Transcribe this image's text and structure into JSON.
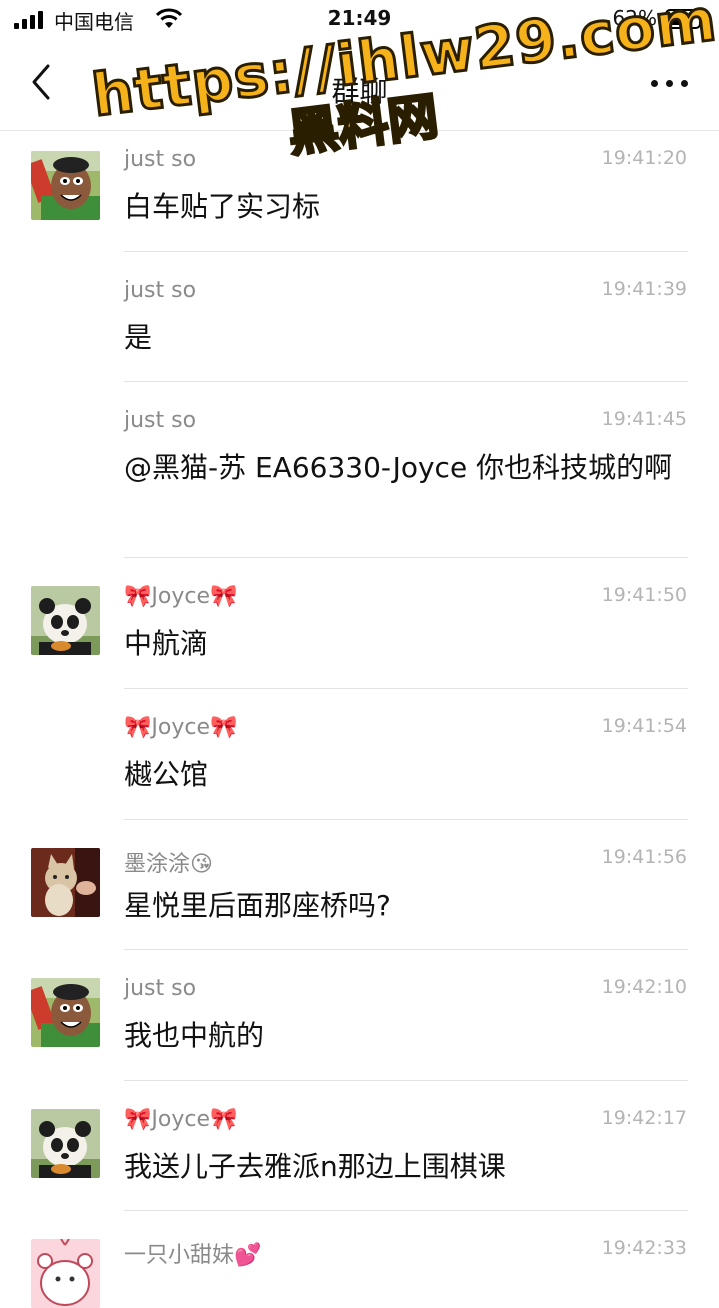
{
  "status_bar": {
    "carrier": "中国电信",
    "time": "21:49",
    "battery_percent": "62%",
    "battery_level": 0.62
  },
  "nav": {
    "title": "群聊",
    "back_icon": "chevron-left-icon",
    "more_icon": "more-dots-icon"
  },
  "watermark": {
    "url": "https://ihlw29.com",
    "text": "黑料网"
  },
  "messages": [
    {
      "sender": "just so",
      "time": "19:41:20",
      "text": "白车贴了实习标",
      "avatar": "cartoon-man-avatar"
    },
    {
      "sender": "just so",
      "time": "19:41:39",
      "text": "是"
    },
    {
      "sender": "just so",
      "time": "19:41:45",
      "text": "@黑猫-苏 EA66330-Joyce 你也科技城的啊"
    },
    {
      "sender": "🎀Joyce🎀",
      "time": "19:41:50",
      "text": "中航滴",
      "avatar": "panda-avatar"
    },
    {
      "sender": "🎀Joyce🎀",
      "time": "19:41:54",
      "text": "樾公馆"
    },
    {
      "sender": "墨涂涂😘",
      "time": "19:41:56",
      "text": "星悦里后面那座桥吗?",
      "avatar": "cat-avatar"
    },
    {
      "sender": "just so",
      "time": "19:42:10",
      "text": "我也中航的",
      "avatar": "cartoon-man-avatar"
    },
    {
      "sender": "🎀Joyce🎀",
      "time": "19:42:17",
      "text": "我送儿子去雅派n那边上围棋课",
      "avatar": "panda-avatar"
    },
    {
      "sender": "一只小甜妹💕",
      "time": "19:42:33",
      "text": "",
      "avatar": "pink-cartoon-avatar"
    }
  ]
}
